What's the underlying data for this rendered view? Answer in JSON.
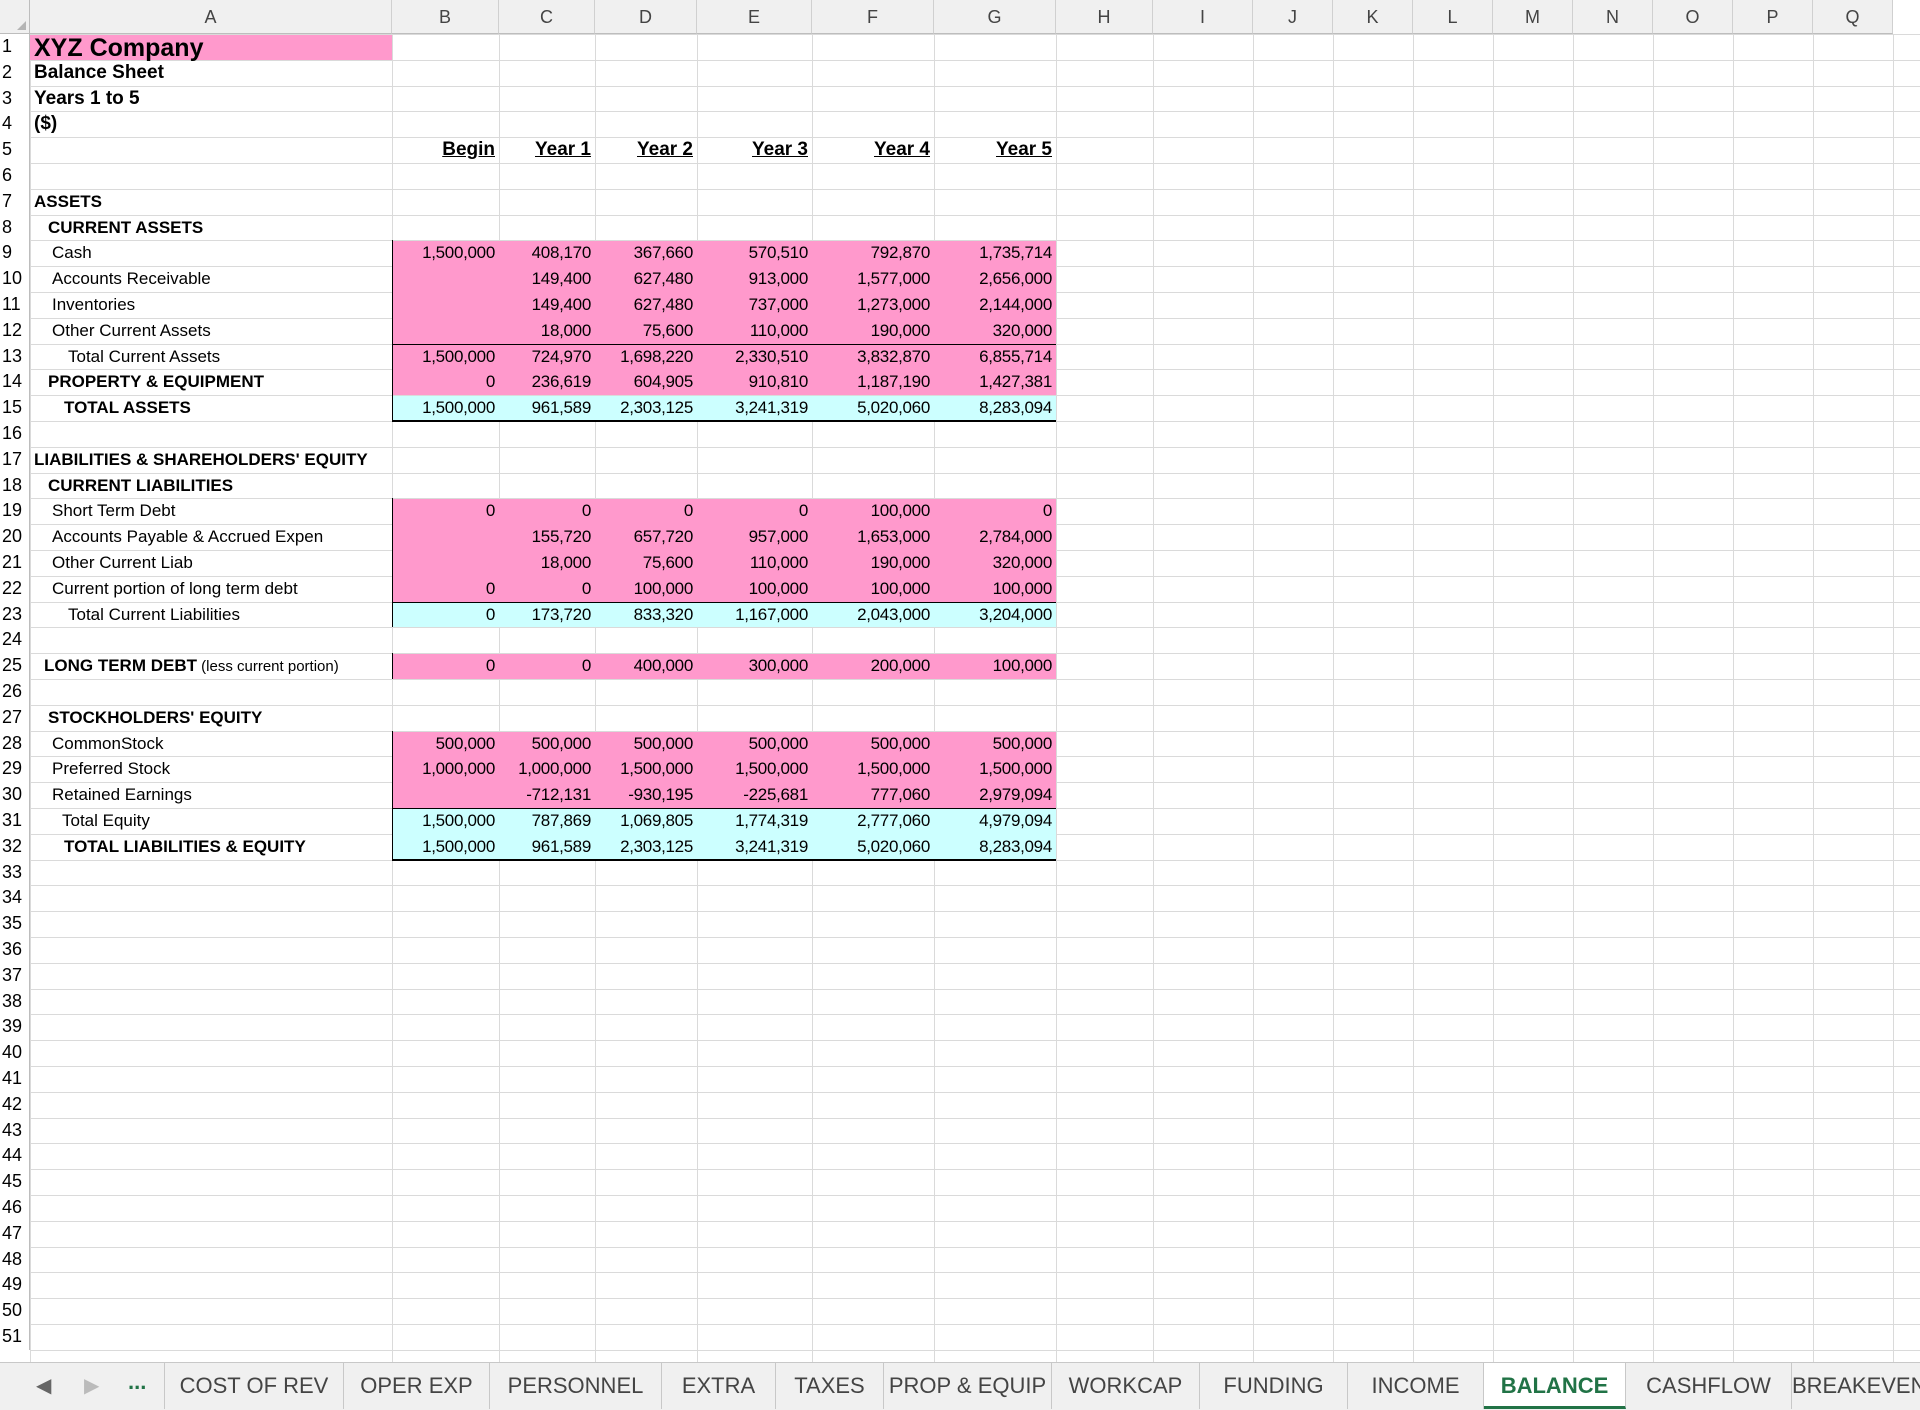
{
  "colors": {
    "pink": "#ff99cc",
    "cyan": "#ccffff",
    "accent": "#217346"
  },
  "columns": [
    "A",
    "B",
    "C",
    "D",
    "E",
    "F",
    "G",
    "H",
    "I",
    "J",
    "K",
    "L",
    "M",
    "N",
    "O",
    "P",
    "Q"
  ],
  "rows_count": 51,
  "titles": {
    "company": "XYZ Company",
    "sheet": "Balance Sheet",
    "period": "Years 1 to 5",
    "units": "($)"
  },
  "headers": [
    "Begin",
    "Year 1",
    "Year 2",
    "Year 3",
    "Year 4",
    "Year 5"
  ],
  "labels": {
    "assets": "ASSETS",
    "current_assets": "CURRENT ASSETS",
    "cash": "Cash",
    "ar": "Accounts Receivable",
    "inventories": "Inventories",
    "other_ca": "Other Current Assets",
    "total_ca": "Total Current Assets",
    "ppe": "PROPERTY & EQUIPMENT",
    "total_assets": "TOTAL ASSETS",
    "liab_equity": "LIABILITIES & SHAREHOLDERS' EQUITY",
    "current_liab": "CURRENT LIABILITIES",
    "std": "Short Term Debt",
    "ap": "Accounts Payable & Accrued Expen",
    "other_cl": "Other Current Liab",
    "cpltd": "Current portion of long term debt",
    "total_cl": "Total Current Liabilities",
    "ltd": "LONG TERM DEBT",
    "ltd_note": "(less current portion)",
    "equity": "STOCKHOLDERS' EQUITY",
    "common": "CommonStock",
    "preferred": "Preferred Stock",
    "retained": "Retained Earnings",
    "total_eq": "Total Equity",
    "total_le": "TOTAL LIABILITIES & EQUITY"
  },
  "values": {
    "cash": [
      "1,500,000",
      "408,170",
      "367,660",
      "570,510",
      "792,870",
      "1,735,714"
    ],
    "ar": [
      "",
      "149,400",
      "627,480",
      "913,000",
      "1,577,000",
      "2,656,000"
    ],
    "inventories": [
      "",
      "149,400",
      "627,480",
      "737,000",
      "1,273,000",
      "2,144,000"
    ],
    "other_ca": [
      "",
      "18,000",
      "75,600",
      "110,000",
      "190,000",
      "320,000"
    ],
    "total_ca": [
      "1,500,000",
      "724,970",
      "1,698,220",
      "2,330,510",
      "3,832,870",
      "6,855,714"
    ],
    "ppe": [
      "0",
      "236,619",
      "604,905",
      "910,810",
      "1,187,190",
      "1,427,381"
    ],
    "total_assets": [
      "1,500,000",
      "961,589",
      "2,303,125",
      "3,241,319",
      "5,020,060",
      "8,283,094"
    ],
    "std": [
      "0",
      "0",
      "0",
      "0",
      "100,000",
      "0"
    ],
    "ap": [
      "",
      "155,720",
      "657,720",
      "957,000",
      "1,653,000",
      "2,784,000"
    ],
    "other_cl": [
      "",
      "18,000",
      "75,600",
      "110,000",
      "190,000",
      "320,000"
    ],
    "cpltd": [
      "0",
      "0",
      "100,000",
      "100,000",
      "100,000",
      "100,000"
    ],
    "total_cl": [
      "0",
      "173,720",
      "833,320",
      "1,167,000",
      "2,043,000",
      "3,204,000"
    ],
    "ltd": [
      "0",
      "0",
      "400,000",
      "300,000",
      "200,000",
      "100,000"
    ],
    "common": [
      "500,000",
      "500,000",
      "500,000",
      "500,000",
      "500,000",
      "500,000"
    ],
    "preferred": [
      "1,000,000",
      "1,000,000",
      "1,500,000",
      "1,500,000",
      "1,500,000",
      "1,500,000"
    ],
    "retained": [
      "",
      "-712,131",
      "-930,195",
      "-225,681",
      "777,060",
      "2,979,094"
    ],
    "total_eq": [
      "1,500,000",
      "787,869",
      "1,069,805",
      "1,774,319",
      "2,777,060",
      "4,979,094"
    ],
    "total_le": [
      "1,500,000",
      "961,589",
      "2,303,125",
      "3,241,319",
      "5,020,060",
      "8,283,094"
    ]
  },
  "tabs": {
    "nav_prev": "◀",
    "nav_next": "▶",
    "more": "...",
    "items": [
      "COST OF REV",
      "OPER EXP",
      "PERSONNEL",
      "EXTRA",
      "TAXES",
      "PROP & EQUIP",
      "WORKCAP",
      "FUNDING",
      "INCOME",
      "BALANCE",
      "CASHFLOW",
      "BREAKEVEN"
    ],
    "active": "BALANCE"
  }
}
